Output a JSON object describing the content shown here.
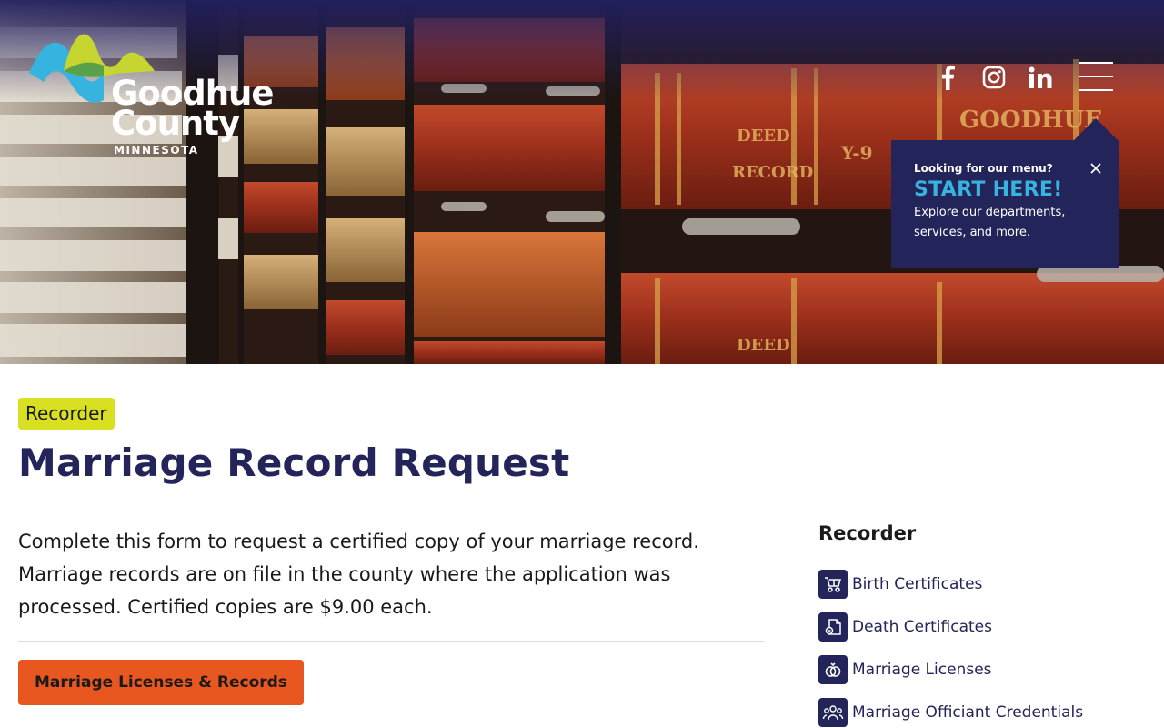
{
  "logo": {
    "line1": "Goodhue",
    "line2": "County",
    "sub": "MINNESOTA"
  },
  "header": {
    "social": [
      {
        "name": "facebook-icon"
      },
      {
        "name": "instagram-icon"
      },
      {
        "name": "linkedin-icon"
      }
    ],
    "menu_icon": "hamburger-menu-icon"
  },
  "popup": {
    "eyebrow": "Looking for our menu?",
    "cta": "START HERE!",
    "description": "Explore our departments, services, and more."
  },
  "page": {
    "tag": "Recorder",
    "title": "Marriage Record Request",
    "intro": "Complete this form to request a certified copy of your marriage record. Marriage records are on file in the county where the application was processed. Certified copies are $9.00 each.",
    "button_label": "Marriage Licenses & Records"
  },
  "sidebar": {
    "title": "Recorder",
    "items": [
      {
        "label": "Birth Certificates",
        "icon": "baby-stroller-icon"
      },
      {
        "label": "Death Certificates",
        "icon": "document-icon"
      },
      {
        "label": "Marriage Licenses",
        "icon": "rings-icon"
      },
      {
        "label": "Marriage Officiant Credentials",
        "icon": "people-icon"
      }
    ]
  },
  "colors": {
    "navy": "#232459",
    "accent_cyan": "#36b3df",
    "tag_yellow": "#d9e021",
    "button_orange": "#e8571f"
  }
}
